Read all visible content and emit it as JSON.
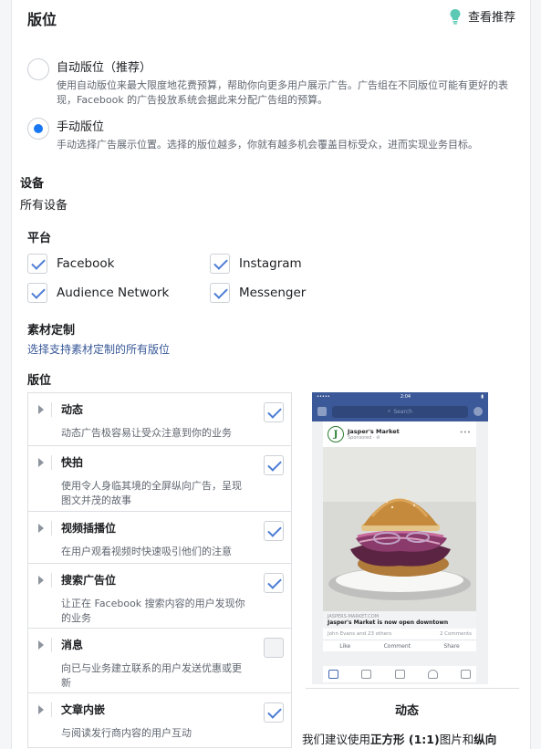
{
  "header": {
    "title": "版位",
    "recommendations_label": "查看推荐"
  },
  "placement_mode": {
    "options": [
      {
        "label": "自动版位（推荐）",
        "description": "使用自动版位来最大限度地花费预算，帮助你向更多用户展示广告。广告组在不同版位可能有更好的表现，Facebook 的广告投放系统会据此来分配广告组的预算。",
        "selected": false
      },
      {
        "label": "手动版位",
        "description": "手动选择广告展示位置。选择的版位越多，你就有越多机会覆盖目标受众，进而实现业务目标。",
        "selected": true
      }
    ]
  },
  "devices": {
    "label": "设备",
    "value": "所有设备"
  },
  "platforms": {
    "label": "平台",
    "items": [
      {
        "name": "Facebook",
        "checked": true
      },
      {
        "name": "Instagram",
        "checked": true
      },
      {
        "name": "Audience Network",
        "checked": true
      },
      {
        "name": "Messenger",
        "checked": true
      }
    ]
  },
  "asset_customization": {
    "label": "素材定制",
    "link": "选择支持素材定制的所有版位"
  },
  "placements": {
    "label": "版位",
    "items": [
      {
        "name": "动态",
        "description": "动态广告极容易让受众注意到你的业务",
        "checked": true
      },
      {
        "name": "快拍",
        "description": "使用令人身临其境的全屏纵向广告，呈现图文并茂的故事",
        "checked": true
      },
      {
        "name": "视频插播位",
        "description": "在用户观看视频时快速吸引他们的注意",
        "checked": true
      },
      {
        "name": "搜索广告位",
        "description": "让正在 Facebook 搜索内容的用户发现你的业务",
        "checked": true
      },
      {
        "name": "消息",
        "description": "向已与业务建立联系的用户发送优惠或更新",
        "checked": false
      },
      {
        "name": "文章内嵌",
        "description": "与阅读发行商内容的用户互动",
        "checked": true
      }
    ]
  },
  "preview": {
    "status_time": "2:04",
    "status_signal": "•••••",
    "search_placeholder": "Search",
    "advertiser": "Jasper's Market",
    "logo_letter": "J",
    "sponsored": "Sponsored · ⊘",
    "domain": "JASPERS-MARKET.COM",
    "headline": "Jasper's Market is now open downtown",
    "reactions": "John Evans and 23 others",
    "comments": "2 Comments",
    "actions": [
      "Like",
      "Comment",
      "Share"
    ],
    "title": "动态",
    "description_prefix": "我们建议使用",
    "description_bold": "正方形 (1:1)",
    "description_mid": "图片和",
    "description_tail": "纵向"
  },
  "colors": {
    "accent": "#1877f2",
    "fb_blue": "#3b5998",
    "check": "#4c7cd4",
    "link": "#385898"
  }
}
